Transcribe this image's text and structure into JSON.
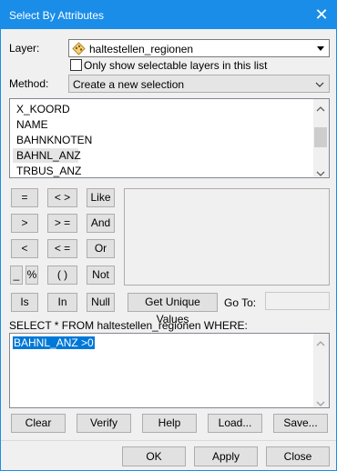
{
  "window": {
    "title": "Select By Attributes",
    "close_glyph": "✕"
  },
  "layer": {
    "label": "Layer:",
    "value": "haltestellen_regionen",
    "only_selectable_label": "Only show selectable layers in this list",
    "only_selectable_checked": false
  },
  "method": {
    "label": "Method:",
    "value": "Create a new selection"
  },
  "fields": {
    "items": [
      "X_KOORD",
      "NAME",
      "BAHNKNOTEN",
      "BAHNL_ANZ",
      "TRBUS_ANZ"
    ],
    "highlighted": "BAHNL_ANZ"
  },
  "operators": {
    "eq": "=",
    "ne": "< >",
    "like": "Like",
    "gt": ">",
    "ge": "> =",
    "and": "And",
    "lt": "<",
    "le": "< =",
    "or": "Or",
    "underscore": "_",
    "percent": "%",
    "parens": "( )",
    "not": "Not",
    "is": "Is",
    "in": "In",
    "null": "Null"
  },
  "unique_values_button": "Get Unique Values",
  "goto_label": "Go To:",
  "goto_value": "",
  "query": {
    "prefix": "SELECT * FROM haltestellen_regionen WHERE:",
    "expression": "BAHNL_ANZ >0"
  },
  "actions": {
    "clear": "Clear",
    "verify": "Verify",
    "help": "Help",
    "load": "Load...",
    "save": "Save..."
  },
  "footer": {
    "ok": "OK",
    "apply": "Apply",
    "close": "Close"
  },
  "colors": {
    "titlebar": "#1a8de8",
    "selection": "#0078d7"
  }
}
